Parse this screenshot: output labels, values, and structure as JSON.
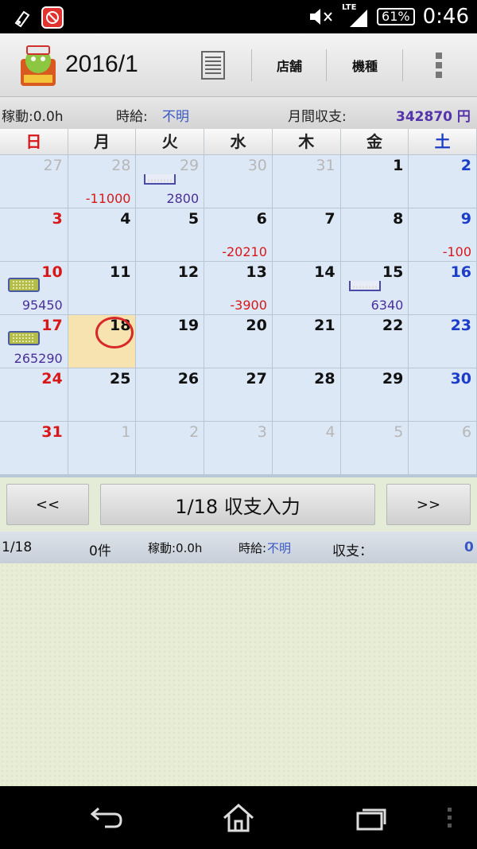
{
  "status": {
    "network": "LTE",
    "battery": "61%",
    "time": "0:46"
  },
  "app": {
    "title": "2016/1",
    "menu_items": [
      "店舗",
      "機種"
    ]
  },
  "info": {
    "operation_label": "稼動:0.0h",
    "wage_label": "時給:",
    "wage_value": "不明",
    "monthly_label": "月間収支:",
    "monthly_value": "342870 円"
  },
  "calendar": {
    "weekdays": [
      "日",
      "月",
      "火",
      "水",
      "木",
      "金",
      "土"
    ],
    "weeks": [
      [
        {
          "d": "27",
          "o": true
        },
        {
          "d": "28",
          "o": true,
          "a": "-11000",
          "n": true
        },
        {
          "d": "29",
          "o": true,
          "a": "2800",
          "t": true
        },
        {
          "d": "30",
          "o": true
        },
        {
          "d": "31",
          "o": true
        },
        {
          "d": "1"
        },
        {
          "d": "2"
        }
      ],
      [
        {
          "d": "3"
        },
        {
          "d": "4"
        },
        {
          "d": "5"
        },
        {
          "d": "6",
          "a": "-20210",
          "n": true
        },
        {
          "d": "7"
        },
        {
          "d": "8"
        },
        {
          "d": "9",
          "a": "-100",
          "n": true
        }
      ],
      [
        {
          "d": "10",
          "a": "95450",
          "t": true
        },
        {
          "d": "11"
        },
        {
          "d": "12"
        },
        {
          "d": "13",
          "a": "-3900",
          "n": true
        },
        {
          "d": "14"
        },
        {
          "d": "15",
          "a": "6340",
          "t": true
        },
        {
          "d": "16"
        }
      ],
      [
        {
          "d": "17",
          "a": "265290",
          "t": true
        },
        {
          "d": "18",
          "today": true
        },
        {
          "d": "19"
        },
        {
          "d": "20"
        },
        {
          "d": "21"
        },
        {
          "d": "22"
        },
        {
          "d": "23"
        }
      ],
      [
        {
          "d": "24"
        },
        {
          "d": "25"
        },
        {
          "d": "26"
        },
        {
          "d": "27"
        },
        {
          "d": "28"
        },
        {
          "d": "29"
        },
        {
          "d": "30"
        }
      ],
      [
        {
          "d": "31"
        },
        {
          "d": "1",
          "o": true
        },
        {
          "d": "2",
          "o": true
        },
        {
          "d": "3",
          "o": true
        },
        {
          "d": "4",
          "o": true
        },
        {
          "d": "5",
          "o": true
        },
        {
          "d": "6",
          "o": true
        }
      ]
    ]
  },
  "nav": {
    "prev_label": "<<",
    "input_label": "1/18 収支入力",
    "next_label": ">>"
  },
  "summary": {
    "date": "1/18",
    "count": "0件",
    "operation": "稼動:0.0h",
    "wage_label": "時給:",
    "wage_value": "不明",
    "balance_label": "収支：",
    "balance_value": "0"
  },
  "colors": {
    "sunday": "#d81818",
    "saturday": "#1c3dc8",
    "negative": "#d81818",
    "positive": "#4a2f9a",
    "today": "#f6e3b0"
  }
}
